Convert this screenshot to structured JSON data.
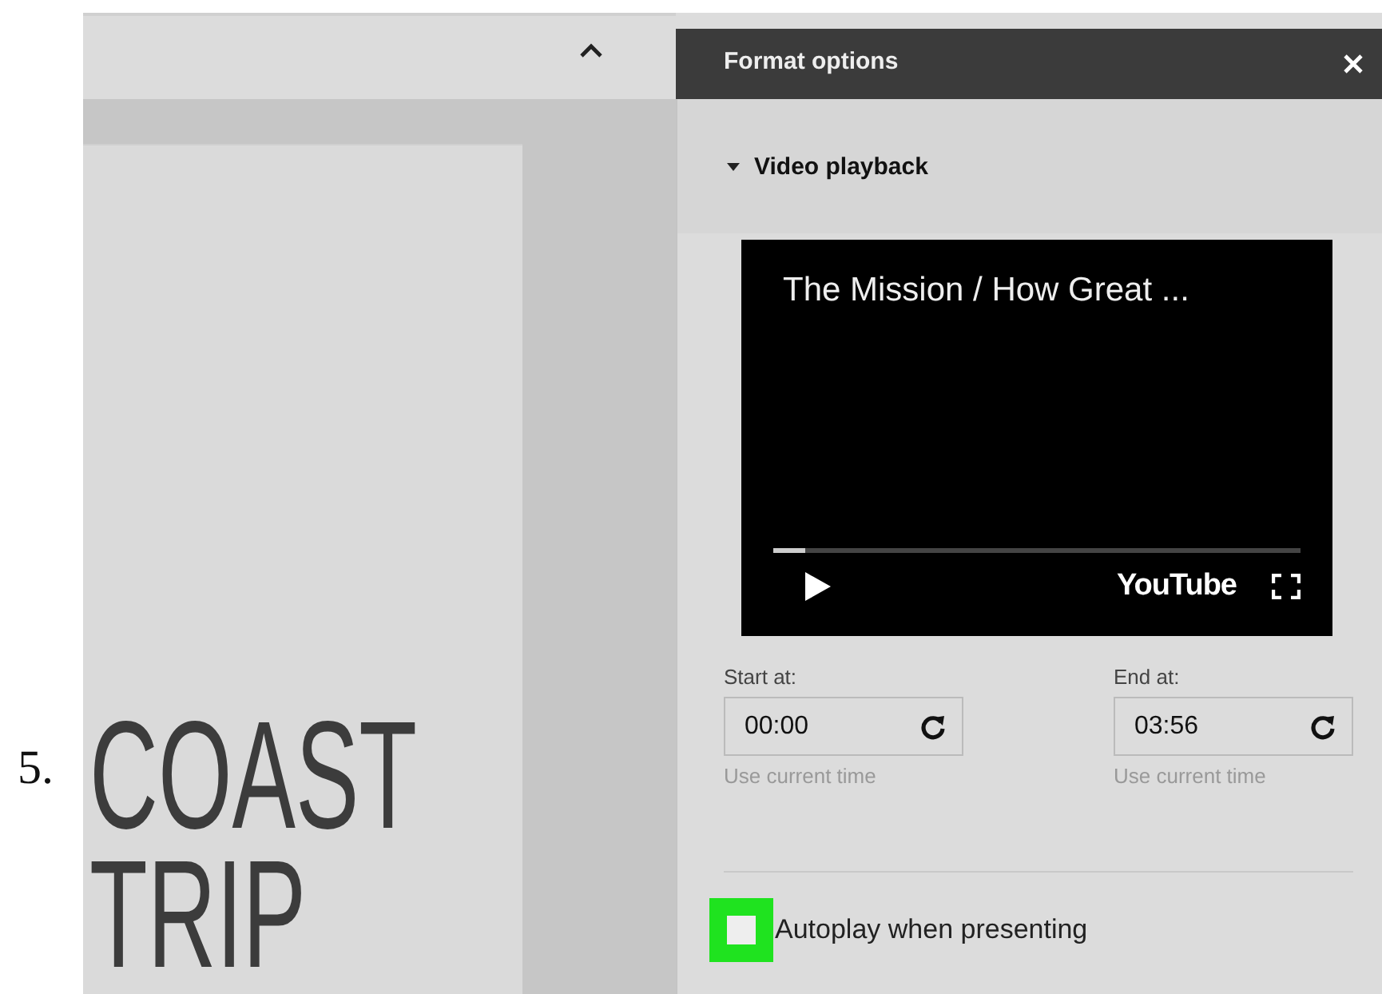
{
  "step_number": "5.",
  "slide": {
    "title_lines": [
      "COAST",
      "TRIP"
    ]
  },
  "panel": {
    "title": "Format options",
    "section": {
      "label": "Video playback",
      "expanded": true
    },
    "video": {
      "title": "The Mission / How Great ...",
      "brand": "YouTube",
      "level": 0.06
    },
    "times": [
      {
        "label": "Start at:",
        "value": "00:00",
        "hint": "Use current time"
      },
      {
        "label": "End at:",
        "value": "03:56",
        "hint": "Use current time"
      }
    ],
    "autoplay": {
      "label": "Autoplay when presenting",
      "checked": false
    }
  }
}
